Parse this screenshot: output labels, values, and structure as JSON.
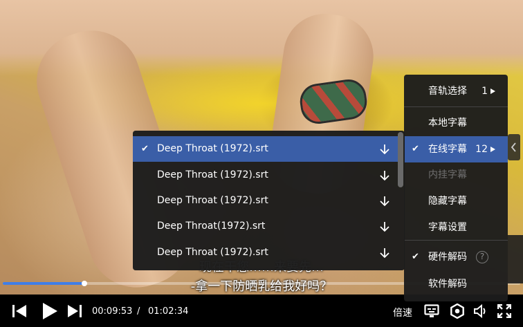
{
  "player": {
    "subtitle_line1": "现在干您……来要先…",
    "subtitle_line2": "-拿一下防晒乳给我好吗？",
    "progress_fraction": 0.158,
    "current_time": "00:09:53",
    "separator": "/",
    "duration": "01:02:34",
    "speed_label": "倍速"
  },
  "controls": {
    "icons": [
      "skip-previous-icon",
      "play-icon",
      "skip-next-icon",
      "subtitle-screen-icon",
      "settings-gear-icon",
      "volume-icon",
      "fullscreen-icon"
    ]
  },
  "settings_menu": {
    "items": [
      {
        "label": "音轨选择",
        "count": "1",
        "has_arrow": true,
        "checked": false,
        "disabled": false,
        "active": false
      },
      {
        "label": "本地字幕",
        "count": "",
        "has_arrow": false,
        "checked": false,
        "disabled": false,
        "active": false
      },
      {
        "label": "在线字幕",
        "count": "12",
        "has_arrow": true,
        "checked": true,
        "disabled": false,
        "active": true
      },
      {
        "label": "内挂字幕",
        "count": "",
        "has_arrow": false,
        "checked": false,
        "disabled": true,
        "active": false
      },
      {
        "label": "隐藏字幕",
        "count": "",
        "has_arrow": false,
        "checked": false,
        "disabled": false,
        "active": false
      },
      {
        "label": "字幕设置",
        "count": "",
        "has_arrow": false,
        "checked": false,
        "disabled": false,
        "active": false
      },
      {
        "label": "硬件解码",
        "count": "",
        "has_arrow": false,
        "checked": true,
        "disabled": false,
        "active": false,
        "help": "?"
      },
      {
        "label": "软件解码",
        "count": "",
        "has_arrow": false,
        "checked": false,
        "disabled": false,
        "active": false
      }
    ]
  },
  "online_subtitles": {
    "items": [
      {
        "label": "Deep Throat (1972).srt",
        "checked": true
      },
      {
        "label": "Deep Throat (1972).srt",
        "checked": false
      },
      {
        "label": "Deep Throat (1972).srt",
        "checked": false
      },
      {
        "label": "Deep Throat(1972).srt",
        "checked": false
      },
      {
        "label": "Deep Throat (1972).srt",
        "checked": false
      }
    ]
  },
  "colors": {
    "accent": "#3a5ea7",
    "progress": "#3f7ee8",
    "menu_bg": "#1c1c1c",
    "disabled_text": "#6f6f6f"
  }
}
